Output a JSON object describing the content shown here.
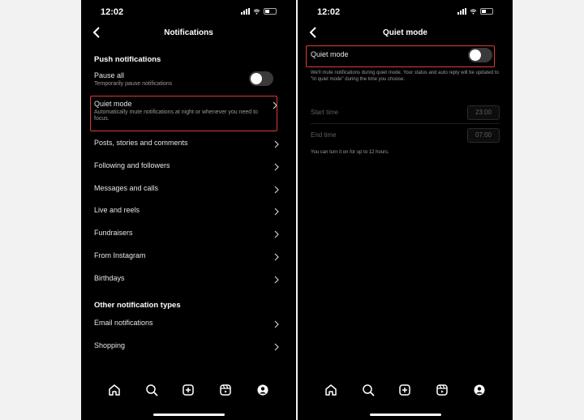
{
  "status": {
    "time": "12:02"
  },
  "left": {
    "title": "Notifications",
    "push_header": "Push notifications",
    "pause_all": {
      "label": "Pause all",
      "sub": "Temporarily pause notifications"
    },
    "quiet_mode": {
      "label": "Quiet mode",
      "sub": "Automatically mute notifications at night or whenever you need to focus."
    },
    "items": [
      "Posts, stories and comments",
      "Following and followers",
      "Messages and calls",
      "Live and reels",
      "Fundraisers",
      "From Instagram",
      "Birthdays"
    ],
    "other_header": "Other notification types",
    "other_items": [
      "Email notifications",
      "Shopping"
    ]
  },
  "right": {
    "title": "Quiet mode",
    "quiet_label": "Quiet mode",
    "description": "We'll mute notifications during quiet mode. Your status and auto reply will be updated to \"In quiet mode\" during the time you choose.",
    "start_label": "Start time",
    "start_value": "23:00",
    "end_label": "End time",
    "end_value": "07:00",
    "hint": "You can turn it on for up to 12 hours."
  },
  "colors": {
    "highlight": "#d93b3b",
    "background": "#000000",
    "toggle_off": "#3a3a3a"
  }
}
